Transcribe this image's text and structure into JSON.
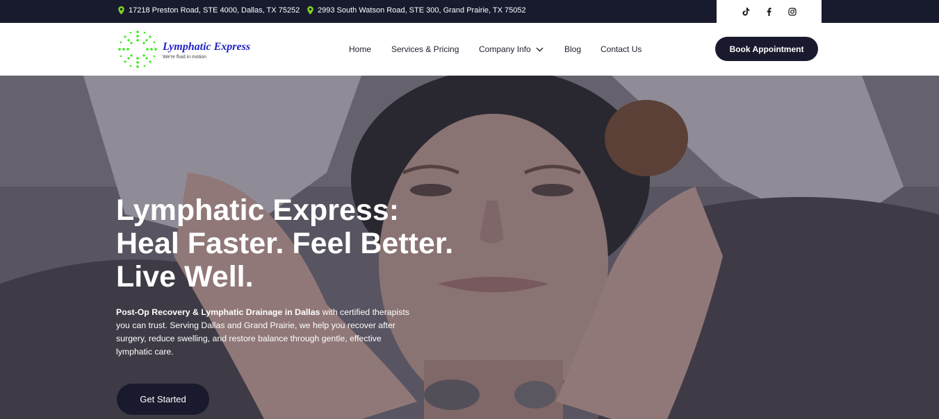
{
  "topbar": {
    "address_1": "17218 Preston Road, STE 4000, Dallas, TX 75252",
    "address_2": "2993 South Watson Road, STE 300, Grand Prairie, TX 75052",
    "pin_color": "#7ed321",
    "social_icons": [
      "tiktok-icon",
      "facebook-icon",
      "instagram-icon"
    ]
  },
  "header": {
    "logo_title": "Lymphatic Express",
    "logo_tagline": "We're fluid in motion",
    "logo_color": "#1f22c7",
    "logo_mark_color": "#39e81a",
    "nav": {
      "home": "Home",
      "services": "Services & Pricing",
      "company": "Company Info",
      "blog": "Blog",
      "contact": "Contact Us"
    },
    "book_button": "Book Appointment"
  },
  "hero": {
    "title_line_1": "Lymphatic Express:",
    "title_line_2": "Heal Faster. Feel Better.",
    "title_line_3": "Live Well.",
    "body_bold": "Post-Op Recovery & Lymphatic Drainage in Dallas",
    "body_rest": " with certified therapists you can trust. Serving Dallas and Grand Prairie, we help you recover after surgery, reduce swelling, and restore balance through gentle, effective lymphatic care.",
    "cta_label": "Get Started",
    "dark_color": "#1a1a2e"
  }
}
